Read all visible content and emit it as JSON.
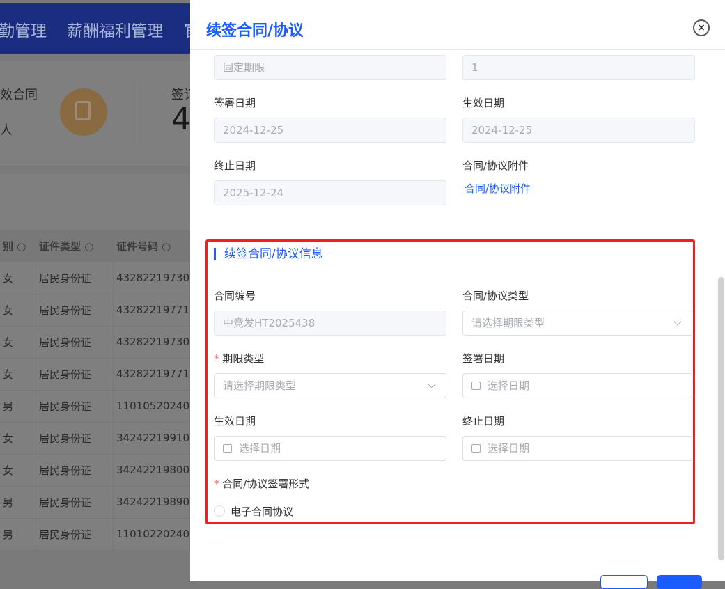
{
  "background": {
    "nav": [
      "勤管理",
      "薪酬福利管理",
      "官"
    ],
    "stats": {
      "label1": "效合同",
      "value1": "人",
      "label2": "签订",
      "value2": "4"
    },
    "table": {
      "headers": [
        "别",
        "证件类型",
        "证件号码"
      ],
      "rows": [
        [
          "女",
          "居民身份证",
          "43282219730"
        ],
        [
          "女",
          "居民身份证",
          "43282219771"
        ],
        [
          "女",
          "居民身份证",
          "43282219730"
        ],
        [
          "女",
          "居民身份证",
          "43282219771"
        ],
        [
          "男",
          "居民身份证",
          "11010520240"
        ],
        [
          "女",
          "居民身份证",
          "34242219910"
        ],
        [
          "女",
          "居民身份证",
          "34242219800"
        ],
        [
          "男",
          "居民身份证",
          "34242219890"
        ],
        [
          "男",
          "居民身份证",
          "11010220240"
        ]
      ]
    }
  },
  "drawer": {
    "title": "续签合同/协议",
    "top": {
      "term_type_value": "固定期限",
      "term_value": "1",
      "sign_date_label": "签署日期",
      "sign_date_value": "2024-12-25",
      "effective_date_label": "生效日期",
      "effective_date_value": "2024-12-25",
      "end_date_label": "终止日期",
      "end_date_value": "2025-12-24",
      "attachment_label": "合同/协议附件",
      "attachment_link": "合同/协议附件"
    },
    "renew": {
      "section_title": "续签合同/协议信息",
      "contract_no_label": "合同编号",
      "contract_no_value": "中竞发HT2025438",
      "type_label": "合同/协议类型",
      "type_placeholder": "请选择期限类型",
      "term_type_label": "期限类型",
      "term_type_placeholder": "请选择期限类型",
      "sign_date_label": "签署日期",
      "sign_date_placeholder": "选择日期",
      "effective_date_label": "生效日期",
      "effective_date_placeholder": "选择日期",
      "end_date_label": "终止日期",
      "end_date_placeholder": "选择日期",
      "sign_form_label": "合同/协议签署形式",
      "sign_form_option": "电子合同协议"
    }
  }
}
